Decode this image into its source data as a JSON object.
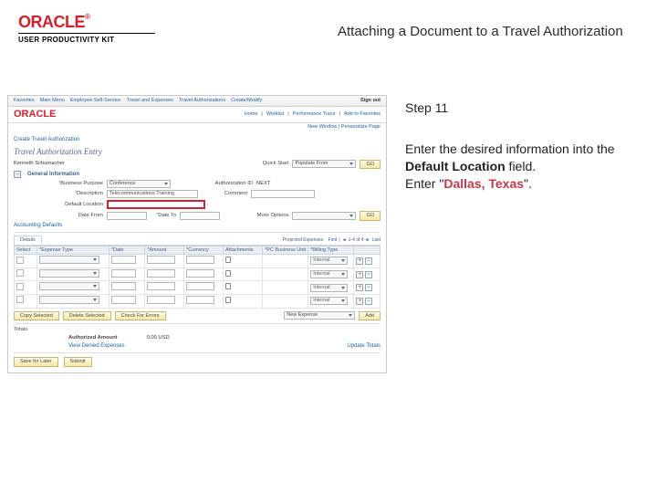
{
  "header": {
    "logo_text": "ORACLE",
    "logo_sub": "USER PRODUCTIVITY KIT",
    "title": "Attaching a Document to a Travel Authorization"
  },
  "instruction": {
    "step_label": "Step 11",
    "line1": "Enter the desired information into the ",
    "bold_field": "Default Location",
    "line1_tail": " field.",
    "line2_prefix": "Enter \"",
    "entry_value": "Dallas, Texas",
    "line2_suffix": "\"."
  },
  "ps": {
    "topnav": {
      "items": [
        "Favorites",
        "Main Menu",
        "Employee Self-Service",
        "Travel and Expenses",
        "Travel Authorizations",
        "Create/Modify"
      ],
      "rightlinks": [
        "Home",
        "Worklist",
        "Performance Trace",
        "Add to Favorites"
      ],
      "signout": "Sign out"
    },
    "subnav": {
      "pages": [
        "Home",
        "Worklist",
        "Add to Favorites",
        "Sign out"
      ],
      "links": [
        "New Window",
        "Personalize Page"
      ]
    },
    "crumbs": "Create Travel Authorization",
    "page_title": "Travel Authorization Entry",
    "emp_name": "Kenneth Schumacher",
    "quickstart_lbl": "Quick Start",
    "quickstart_val": "Populate From",
    "go": "GO",
    "gen_section": "General Information",
    "biz_purpose_lbl": "Business Purpose",
    "biz_purpose_val": "Conference",
    "desc_lbl": "Description",
    "desc_val": "Telecommunications Training",
    "authid_lbl": "Authorization ID",
    "authid_val": "NEXT",
    "comment_lbl": "Comment",
    "default_loc_lbl": "Default Location",
    "date_from_lbl": "Date From",
    "date_to_lbl": "Date To",
    "acct_section": "Accounting Defaults",
    "more_lbl": "More Options",
    "details_tab": "Details",
    "grid_label": "Projected Expenses",
    "grid_nav": {
      "find": "Find",
      "range": "1-4 of 4",
      "last": "Last"
    },
    "cols": {
      "select": "Select",
      "type": "*Expense Type",
      "date": "*Date",
      "amount": "*Amount",
      "currency": "*Currency",
      "attachments": "Attachments",
      "pc": "*PC Business Unit",
      "billing": "*Billing Type"
    },
    "rows": [
      {
        "attach": "",
        "billing": "Internal"
      },
      {
        "attach": "",
        "billing": "Internal"
      },
      {
        "attach": "",
        "billing": "Internal"
      },
      {
        "attach": "",
        "billing": "Internal"
      }
    ],
    "copy_btn": "Copy Selected",
    "delete_btn": "Delete Selected",
    "check_btn": "Check For Errors",
    "new_expense_ph": "New Expense",
    "add": "Add",
    "totals_label": "Totals",
    "auth_amt_lbl": "Authorized Amount",
    "auth_amt_val": "0.00  USD",
    "denied_lbl": "View Denied Expenses",
    "update_lbl": "Update Totals",
    "save_btn": "Save for Later",
    "submit_btn": "Submit"
  }
}
